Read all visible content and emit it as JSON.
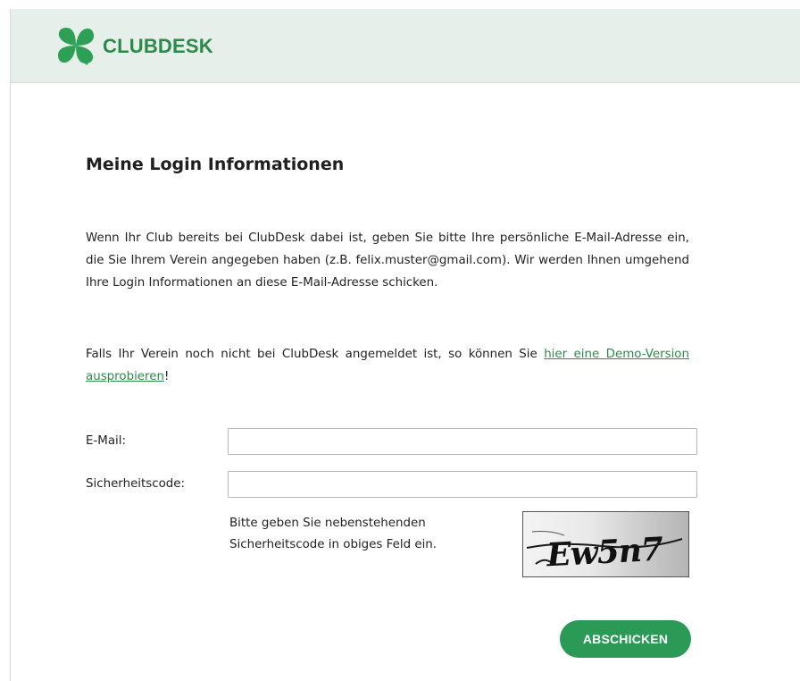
{
  "brand": {
    "name": "CLUBDESK",
    "color": "#2b8a4a",
    "logo_icon": "four-leaf-clover-icon"
  },
  "page": {
    "title": "Meine Login Informationen",
    "intro": "Wenn Ihr Club bereits bei ClubDesk dabei ist, geben Sie bitte Ihre persönliche E-Mail-Adresse ein, die Sie Ihrem Verein angegeben haben (z.B. felix.muster@gmail.com). Wir werden Ihnen umgehend Ihre Login Informationen an diese E-Mail-Adresse schicken.",
    "demo_prefix": "Falls Ihr Verein noch nicht bei ClubDesk angemeldet ist, so können Sie ",
    "demo_link": "hier eine Demo-Version ausprobieren",
    "demo_suffix": "!"
  },
  "form": {
    "email_label": "E-Mail:",
    "email_value": "",
    "code_label": "Sicherheitscode:",
    "code_value": "",
    "captcha_hint": "Bitte geben Sie nebenstehenden Sicherheitscode in obiges Feld ein.",
    "captcha_text": "Ew5n7",
    "submit_label": "ABSCHICKEN",
    "accent_color": "#2a9a56"
  }
}
